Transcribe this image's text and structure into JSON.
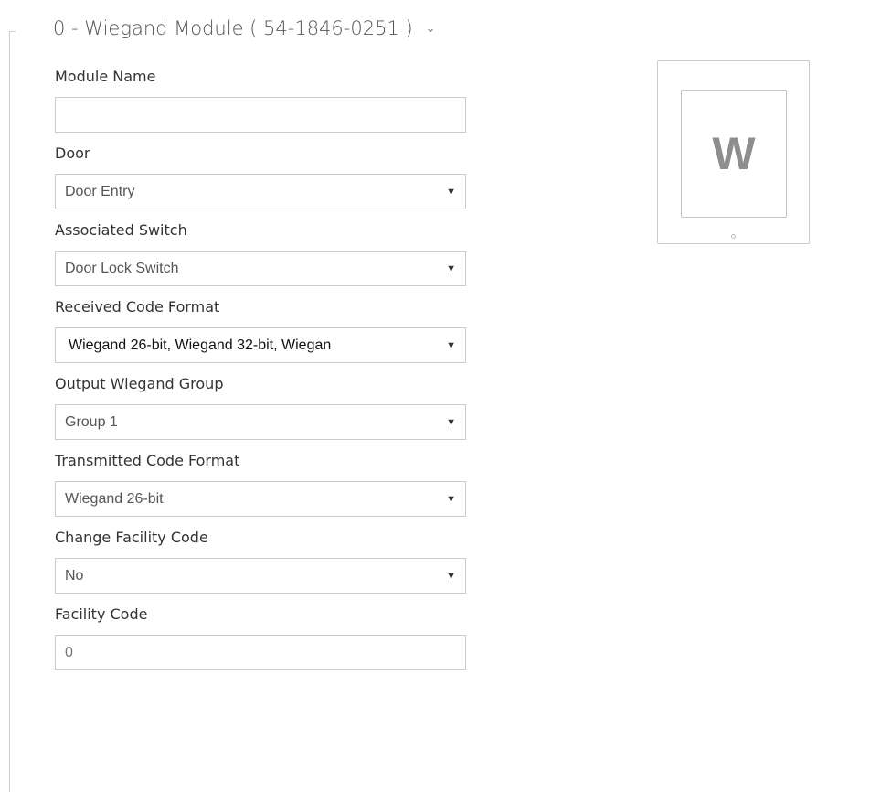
{
  "module": {
    "title": "0 - Wiegand Module ( 54-1846-0251 )",
    "expand_icon": "chevron-down-icon",
    "tile_letter": "W"
  },
  "fields": {
    "module_name": {
      "label": "Module Name",
      "value": ""
    },
    "door": {
      "label": "Door",
      "value": "Door Entry"
    },
    "associated_switch": {
      "label": "Associated Switch",
      "value": "Door Lock Switch"
    },
    "received_code_format": {
      "label": "Received Code Format",
      "value": "Wiegand 26-bit, Wiegand 32-bit, Wiegan"
    },
    "output_wiegand_group": {
      "label": "Output Wiegand Group",
      "value": "Group 1"
    },
    "transmitted_code_format": {
      "label": "Transmitted Code Format",
      "value": "Wiegand 26-bit"
    },
    "change_facility_code": {
      "label": "Change Facility Code",
      "value": "No"
    },
    "facility_code": {
      "label": "Facility Code",
      "value": "0"
    }
  },
  "icons": {
    "dropdown_arrow": "▼",
    "chevron": "⌄"
  },
  "colors": {
    "text": "#333333",
    "border": "#cccccc",
    "tile_letter": "#8e8e8e"
  }
}
